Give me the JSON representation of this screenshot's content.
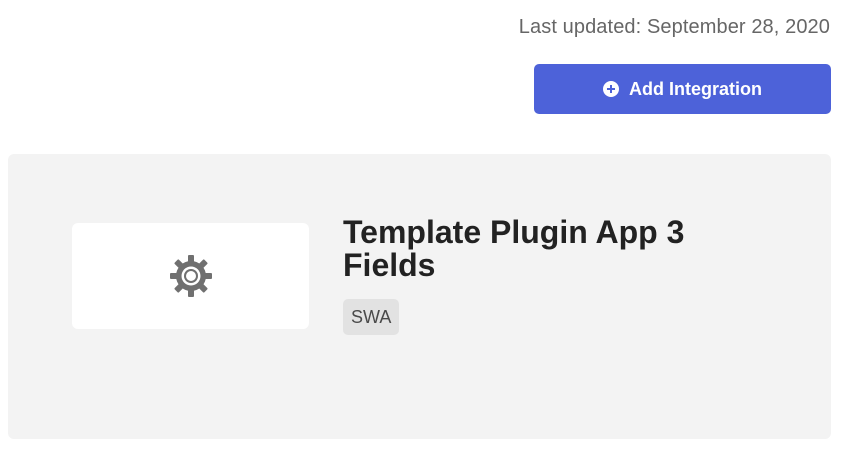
{
  "header": {
    "last_updated": "Last updated: September 28, 2020",
    "add_integration_label": "Add Integration",
    "add_icon": "plus-circle-icon"
  },
  "integration": {
    "logo_icon": "gear-icon",
    "title": "Template Plugin App 3 Fields",
    "tag": "SWA"
  },
  "colors": {
    "accent": "#4d62d9",
    "card_bg": "#f3f3f3",
    "tag_bg": "#e2e2e2"
  }
}
